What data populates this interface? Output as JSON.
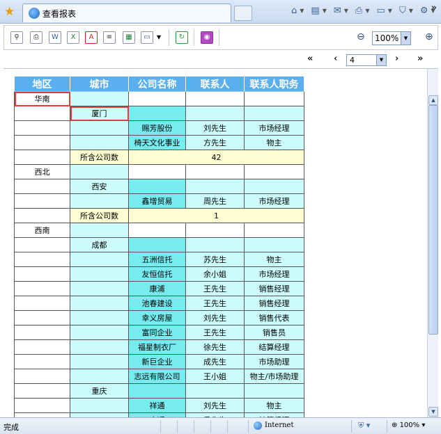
{
  "browser": {
    "tab_title": "查看报表",
    "more_label": "»"
  },
  "toolbar": {
    "zoom_value": "100%"
  },
  "navigation": {
    "first_label": "«",
    "prev_label": "‹",
    "page_value": "4",
    "next_label": "›",
    "last_label": "»"
  },
  "report": {
    "headers": [
      "地区",
      "城市",
      "公司名称",
      "联系人",
      "联系人职务"
    ],
    "rows": [
      {
        "kind": "region",
        "region": "华南"
      },
      {
        "kind": "city",
        "city": "厦门"
      },
      {
        "kind": "data",
        "company": "赐芳股份",
        "contact": "刘先生",
        "title": "市场经理"
      },
      {
        "kind": "data",
        "company": "椅天文化事业",
        "contact": "方先生",
        "title": "物主"
      },
      {
        "kind": "sum",
        "label": "所含公司数",
        "count": "42"
      },
      {
        "kind": "region",
        "region": "西北"
      },
      {
        "kind": "city",
        "city": "西安"
      },
      {
        "kind": "data",
        "company": "鑫增贸易",
        "contact": "周先生",
        "title": "市场经理"
      },
      {
        "kind": "sum",
        "label": "所含公司数",
        "count": "1"
      },
      {
        "kind": "region",
        "region": "西南"
      },
      {
        "kind": "city",
        "city": "成都"
      },
      {
        "kind": "data",
        "company": "五洲信托",
        "contact": "苏先生",
        "title": "物主"
      },
      {
        "kind": "data",
        "company": "友恒信托",
        "contact": "余小姐",
        "title": "市场经理"
      },
      {
        "kind": "data",
        "company": "康浦",
        "contact": "王先生",
        "title": "销售经理"
      },
      {
        "kind": "data",
        "company": "池春建设",
        "contact": "王先生",
        "title": "销售经理"
      },
      {
        "kind": "data",
        "company": "幸义房屋",
        "contact": "刘先生",
        "title": "销售代表"
      },
      {
        "kind": "data",
        "company": "富同企业",
        "contact": "王先生",
        "title": "销售员"
      },
      {
        "kind": "data",
        "company": "福星制衣厂",
        "contact": "徐先生",
        "title": "结算经理"
      },
      {
        "kind": "data",
        "company": "新巨企业",
        "contact": "成先生",
        "title": "市场助理"
      },
      {
        "kind": "data",
        "company": "志远有限公司",
        "contact": "王小姐",
        "title": "物主/市场助理"
      },
      {
        "kind": "city",
        "city": "重庆"
      },
      {
        "kind": "data",
        "company": "祥通",
        "contact": "刘先生",
        "title": "物主"
      },
      {
        "kind": "data",
        "company": "广通",
        "contact": "季先生",
        "title": "结算经理"
      }
    ]
  },
  "status": {
    "text": "完成",
    "zone": "Internet",
    "zoom": "100%"
  }
}
